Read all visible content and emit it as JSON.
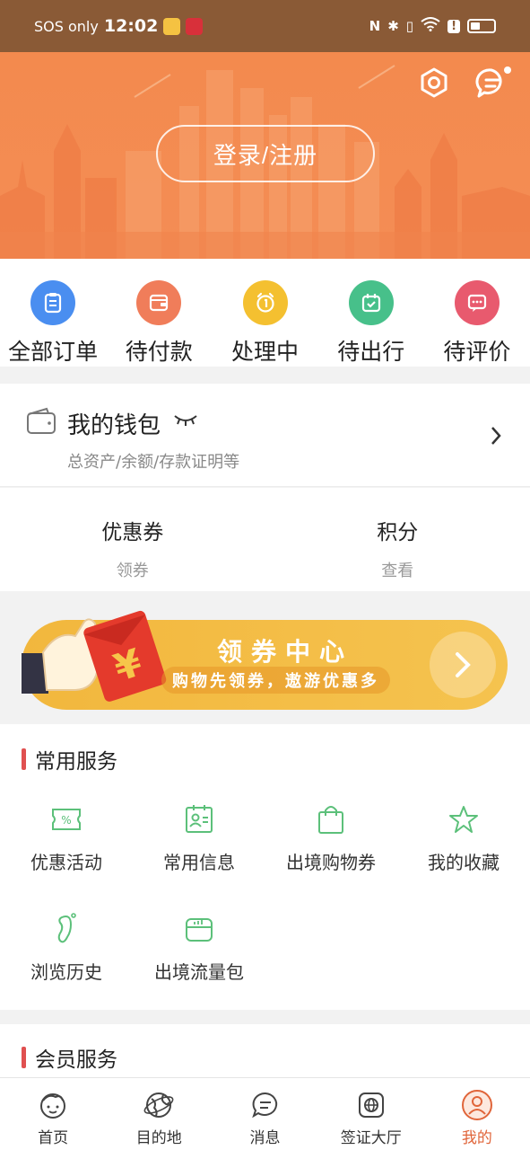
{
  "status": {
    "carrier": "SOS only",
    "time": "12:02",
    "signal_text": "6"
  },
  "hero": {
    "login_label": "登录/注册"
  },
  "orders": [
    {
      "name": "all-orders",
      "label": "全部订单",
      "color": "#4a8ef0",
      "icon": "clipboard-icon"
    },
    {
      "name": "pending-payment",
      "label": "待付款",
      "color": "#f07d5a",
      "icon": "wallet-icon"
    },
    {
      "name": "processing",
      "label": "处理中",
      "color": "#f4c030",
      "icon": "alarm-clock-icon"
    },
    {
      "name": "pending-travel",
      "label": "待出行",
      "color": "#47c08a",
      "icon": "calendar-check-icon"
    },
    {
      "name": "pending-review",
      "label": "待评价",
      "color": "#e85a6e",
      "icon": "chat-icon"
    }
  ],
  "wallet": {
    "title": "我的钱包",
    "subtitle": "总资产/余额/存款证明等"
  },
  "assets": [
    {
      "title": "优惠券",
      "sub": "领券"
    },
    {
      "title": "积分",
      "sub": "查看"
    }
  ],
  "banner": {
    "title": "领券中心",
    "subtitle": "购物先领券，遨游优惠多",
    "badge": "¥"
  },
  "services": {
    "title": "常用服务",
    "items": [
      {
        "label": "优惠活动",
        "icon": "ticket-icon"
      },
      {
        "label": "常用信息",
        "icon": "id-card-icon"
      },
      {
        "label": "出境购物券",
        "icon": "shopping-bag-icon"
      },
      {
        "label": "我的收藏",
        "icon": "star-icon"
      },
      {
        "label": "浏览历史",
        "icon": "footprint-icon"
      },
      {
        "label": "出境流量包",
        "icon": "sim-card-icon"
      }
    ]
  },
  "member": {
    "title": "会员服务"
  },
  "tabs": [
    {
      "label": "首页",
      "icon": "home-face-icon",
      "active": false
    },
    {
      "label": "目的地",
      "icon": "globe-icon",
      "active": false
    },
    {
      "label": "消息",
      "icon": "message-icon",
      "active": false
    },
    {
      "label": "签证大厅",
      "icon": "visa-icon",
      "active": false
    },
    {
      "label": "我的",
      "icon": "profile-icon",
      "active": true
    }
  ],
  "colors": {
    "accent": "#e0653a",
    "hero": "#f38a4e",
    "service_icon": "#5cc07a",
    "banner": "#f2b73d"
  }
}
